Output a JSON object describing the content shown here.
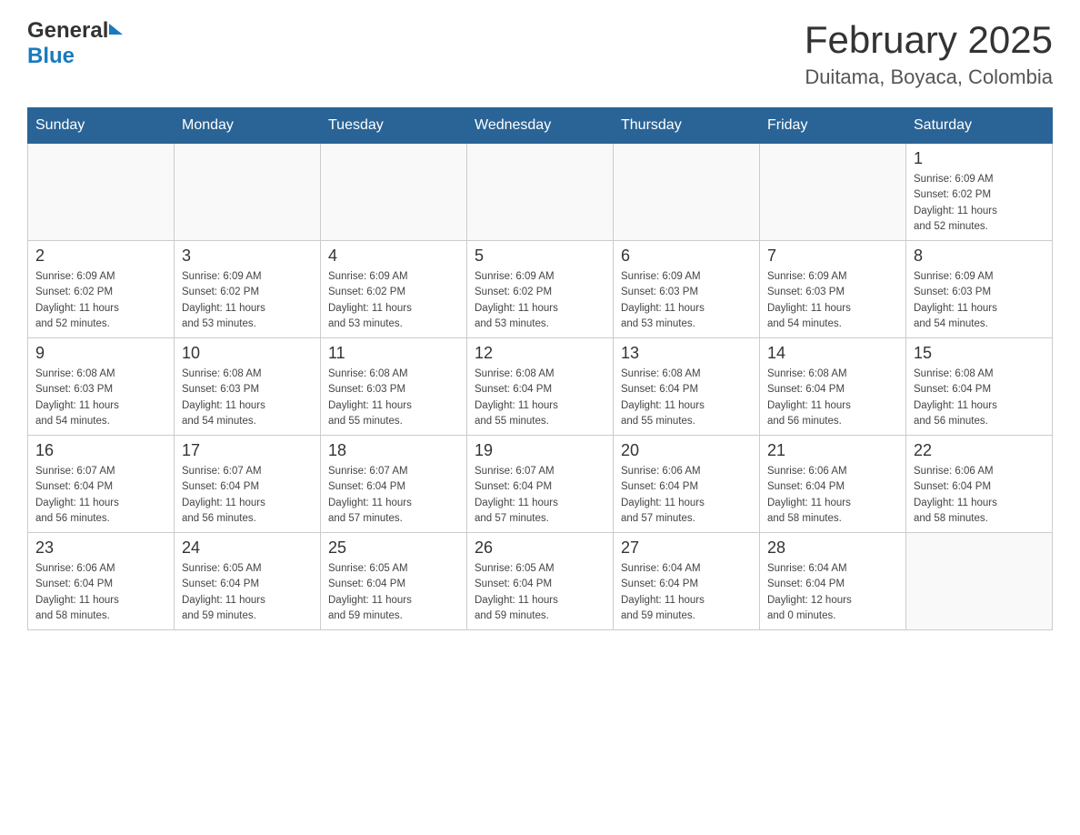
{
  "header": {
    "logo_general": "General",
    "logo_blue": "Blue",
    "title": "February 2025",
    "subtitle": "Duitama, Boyaca, Colombia"
  },
  "calendar": {
    "days_of_week": [
      "Sunday",
      "Monday",
      "Tuesday",
      "Wednesday",
      "Thursday",
      "Friday",
      "Saturday"
    ],
    "weeks": [
      [
        {
          "day": "",
          "info": ""
        },
        {
          "day": "",
          "info": ""
        },
        {
          "day": "",
          "info": ""
        },
        {
          "day": "",
          "info": ""
        },
        {
          "day": "",
          "info": ""
        },
        {
          "day": "",
          "info": ""
        },
        {
          "day": "1",
          "info": "Sunrise: 6:09 AM\nSunset: 6:02 PM\nDaylight: 11 hours\nand 52 minutes."
        }
      ],
      [
        {
          "day": "2",
          "info": "Sunrise: 6:09 AM\nSunset: 6:02 PM\nDaylight: 11 hours\nand 52 minutes."
        },
        {
          "day": "3",
          "info": "Sunrise: 6:09 AM\nSunset: 6:02 PM\nDaylight: 11 hours\nand 53 minutes."
        },
        {
          "day": "4",
          "info": "Sunrise: 6:09 AM\nSunset: 6:02 PM\nDaylight: 11 hours\nand 53 minutes."
        },
        {
          "day": "5",
          "info": "Sunrise: 6:09 AM\nSunset: 6:02 PM\nDaylight: 11 hours\nand 53 minutes."
        },
        {
          "day": "6",
          "info": "Sunrise: 6:09 AM\nSunset: 6:03 PM\nDaylight: 11 hours\nand 53 minutes."
        },
        {
          "day": "7",
          "info": "Sunrise: 6:09 AM\nSunset: 6:03 PM\nDaylight: 11 hours\nand 54 minutes."
        },
        {
          "day": "8",
          "info": "Sunrise: 6:09 AM\nSunset: 6:03 PM\nDaylight: 11 hours\nand 54 minutes."
        }
      ],
      [
        {
          "day": "9",
          "info": "Sunrise: 6:08 AM\nSunset: 6:03 PM\nDaylight: 11 hours\nand 54 minutes."
        },
        {
          "day": "10",
          "info": "Sunrise: 6:08 AM\nSunset: 6:03 PM\nDaylight: 11 hours\nand 54 minutes."
        },
        {
          "day": "11",
          "info": "Sunrise: 6:08 AM\nSunset: 6:03 PM\nDaylight: 11 hours\nand 55 minutes."
        },
        {
          "day": "12",
          "info": "Sunrise: 6:08 AM\nSunset: 6:04 PM\nDaylight: 11 hours\nand 55 minutes."
        },
        {
          "day": "13",
          "info": "Sunrise: 6:08 AM\nSunset: 6:04 PM\nDaylight: 11 hours\nand 55 minutes."
        },
        {
          "day": "14",
          "info": "Sunrise: 6:08 AM\nSunset: 6:04 PM\nDaylight: 11 hours\nand 56 minutes."
        },
        {
          "day": "15",
          "info": "Sunrise: 6:08 AM\nSunset: 6:04 PM\nDaylight: 11 hours\nand 56 minutes."
        }
      ],
      [
        {
          "day": "16",
          "info": "Sunrise: 6:07 AM\nSunset: 6:04 PM\nDaylight: 11 hours\nand 56 minutes."
        },
        {
          "day": "17",
          "info": "Sunrise: 6:07 AM\nSunset: 6:04 PM\nDaylight: 11 hours\nand 56 minutes."
        },
        {
          "day": "18",
          "info": "Sunrise: 6:07 AM\nSunset: 6:04 PM\nDaylight: 11 hours\nand 57 minutes."
        },
        {
          "day": "19",
          "info": "Sunrise: 6:07 AM\nSunset: 6:04 PM\nDaylight: 11 hours\nand 57 minutes."
        },
        {
          "day": "20",
          "info": "Sunrise: 6:06 AM\nSunset: 6:04 PM\nDaylight: 11 hours\nand 57 minutes."
        },
        {
          "day": "21",
          "info": "Sunrise: 6:06 AM\nSunset: 6:04 PM\nDaylight: 11 hours\nand 58 minutes."
        },
        {
          "day": "22",
          "info": "Sunrise: 6:06 AM\nSunset: 6:04 PM\nDaylight: 11 hours\nand 58 minutes."
        }
      ],
      [
        {
          "day": "23",
          "info": "Sunrise: 6:06 AM\nSunset: 6:04 PM\nDaylight: 11 hours\nand 58 minutes."
        },
        {
          "day": "24",
          "info": "Sunrise: 6:05 AM\nSunset: 6:04 PM\nDaylight: 11 hours\nand 59 minutes."
        },
        {
          "day": "25",
          "info": "Sunrise: 6:05 AM\nSunset: 6:04 PM\nDaylight: 11 hours\nand 59 minutes."
        },
        {
          "day": "26",
          "info": "Sunrise: 6:05 AM\nSunset: 6:04 PM\nDaylight: 11 hours\nand 59 minutes."
        },
        {
          "day": "27",
          "info": "Sunrise: 6:04 AM\nSunset: 6:04 PM\nDaylight: 11 hours\nand 59 minutes."
        },
        {
          "day": "28",
          "info": "Sunrise: 6:04 AM\nSunset: 6:04 PM\nDaylight: 12 hours\nand 0 minutes."
        },
        {
          "day": "",
          "info": ""
        }
      ]
    ]
  }
}
